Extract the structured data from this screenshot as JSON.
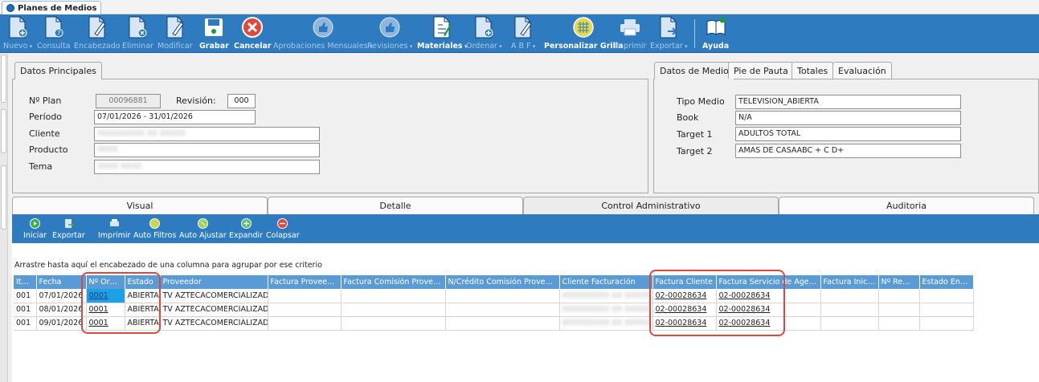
{
  "window": {
    "tab_title": "Planes de Medios"
  },
  "toolbar": [
    {
      "label": "Nuevo",
      "dropdown": true,
      "enabled": false,
      "icon": "new-doc-icon"
    },
    {
      "label": "Consulta",
      "dropdown": false,
      "enabled": false,
      "icon": "query-icon"
    },
    {
      "label": "Encabezado",
      "dropdown": false,
      "enabled": false,
      "icon": "edit-header-icon"
    },
    {
      "label": "Eliminar",
      "dropdown": false,
      "enabled": false,
      "icon": "delete-doc-icon"
    },
    {
      "label": "Modificar",
      "dropdown": false,
      "enabled": false,
      "icon": "modify-icon"
    },
    {
      "label": "Grabar",
      "dropdown": false,
      "enabled": true,
      "icon": "save-icon"
    },
    {
      "label": "Cancelar",
      "dropdown": false,
      "enabled": true,
      "icon": "cancel-icon"
    },
    {
      "label": "Aprobaciones Mensuales",
      "dropdown": true,
      "enabled": false,
      "icon": "thumbs-up-icon"
    },
    {
      "label": "Revisiones",
      "dropdown": true,
      "enabled": false,
      "icon": "thumbs-up-icon"
    },
    {
      "label": "Materiales",
      "dropdown": true,
      "enabled": true,
      "icon": "materials-icon"
    },
    {
      "label": "Ordenar",
      "dropdown": true,
      "enabled": false,
      "icon": "order-icon"
    },
    {
      "label": "A B F",
      "dropdown": true,
      "enabled": false,
      "icon": "abf-icon"
    },
    {
      "label": "Personalizar Grilla",
      "dropdown": false,
      "enabled": true,
      "icon": "grid-icon"
    },
    {
      "label": "Imprimir",
      "dropdown": false,
      "enabled": false,
      "icon": "printer-icon"
    },
    {
      "label": "Exportar",
      "dropdown": true,
      "enabled": false,
      "icon": "export-icon"
    },
    {
      "label": "Ayuda",
      "dropdown": false,
      "enabled": true,
      "icon": "help-book-icon"
    }
  ],
  "datos_principales": {
    "tab": "Datos Principales",
    "n_plan_label": "Nº Plan",
    "n_plan_value": "00096881",
    "revision_label": "Revisión:",
    "revision_value": "000",
    "periodo_label": "Período",
    "periodo_value": "07/01/2026 - 31/01/2026",
    "cliente_label": "Cliente",
    "cliente_value": "XXXXXXXXX XX XXXXX",
    "producto_label": "Producto",
    "producto_value": "XXXX",
    "tema_label": "Tema",
    "tema_value": "XXXX XXXX"
  },
  "datos_medio": {
    "tabs": [
      "Datos de Medio",
      "Pie de Pauta",
      "Totales",
      "Evaluación"
    ],
    "tipo_medio_label": "Tipo Medio",
    "tipo_medio_value": "TELEVISION_ABIERTA",
    "book_label": "Book",
    "book_value": "N/A",
    "target1_label": "Target 1",
    "target1_value": "ADULTOS TOTAL",
    "target2_label": "Target 2",
    "target2_value": "AMAS DE CASAABC + C D+"
  },
  "lower_tabs": [
    "Visual",
    "Detalle",
    "Control Administrativo",
    "Auditoria"
  ],
  "toolbar2": [
    {
      "label": "Iniciar",
      "icon": "play-icon"
    },
    {
      "label": "Exportar",
      "icon": "export-icon"
    },
    {
      "label": "Imprimir",
      "icon": "printer-icon"
    },
    {
      "label": "Auto Filtros",
      "icon": "filter-icon"
    },
    {
      "label": "Auto Ajustar",
      "icon": "auto-fit-icon"
    },
    {
      "label": "Expandir",
      "icon": "expand-icon"
    },
    {
      "label": "Colapsar",
      "icon": "collapse-icon"
    }
  ],
  "grid": {
    "group_hint": "Arrastre hasta aquí el encabezado de una columna para agrupar por ese criterio",
    "columns": [
      "Item",
      "Fecha",
      "Nº Orden",
      "Estado",
      "Proveedor",
      "Factura Proveedor",
      "Factura Comisión Provee...",
      "N/Crédito Comisión Provee...",
      "Cliente Facturación",
      "Factura Cliente",
      "Factura Servicio de Agen...",
      "Factura Inicial",
      "Nº Remito",
      "Estado Envio"
    ],
    "rows": [
      [
        "001",
        "07/01/2026",
        "0001",
        "ABIERTA",
        "TV AZTECACOMERCIALIZADO",
        "",
        "",
        "",
        "XXXXXXXXX XX XXXXX",
        "02-00028634",
        "02-00028634",
        "",
        "",
        ""
      ],
      [
        "001",
        "08/01/2026",
        "0001",
        "ABIERTA",
        "TV AZTECACOMERCIALIZADO",
        "",
        "",
        "",
        "XXXXXXXXX XX XXXXX",
        "02-00028634",
        "02-00028634",
        "",
        "",
        ""
      ],
      [
        "001",
        "09/01/2026",
        "0001",
        "ABIERTA",
        "TV AZTECACOMERCIALIZADO",
        "",
        "",
        "",
        "XXXXXXXXX XX XXXXX",
        "02-00028634",
        "02-00028634",
        "",
        "",
        ""
      ]
    ]
  },
  "colors": {
    "toolbar_blue": "#2f7bbf",
    "grid_header": "#5a9ad5",
    "highlight_red": "#d94a3c"
  }
}
